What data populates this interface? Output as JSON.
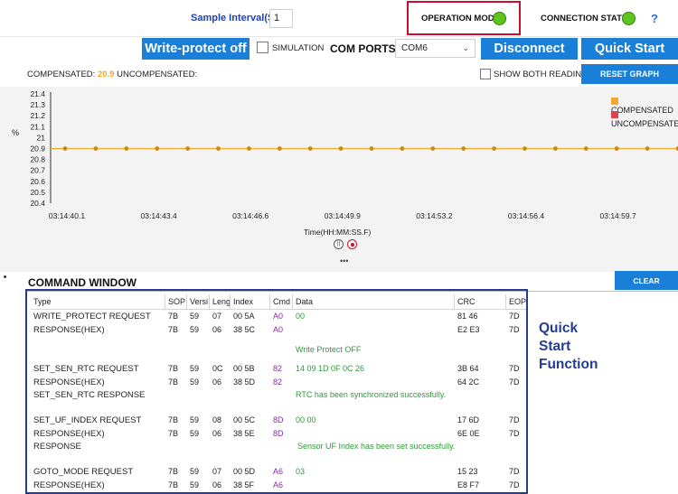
{
  "header": {
    "sample_interval_label": "Sample Interval(S)",
    "sample_interval_value": "1",
    "operation_mode_label": "OPERATION MODE",
    "connection_status_label": "CONNECTION STATUS",
    "help_label": "?",
    "status_led_color": "#5fc41d"
  },
  "toolbar": {
    "write_protect_label": "Write-protect off",
    "simulation_label": "SIMULATION",
    "com_ports_label": "COM PORTS",
    "com_port_selected": "COM6",
    "disconnect_label": "Disconnect",
    "quick_start_label": "Quick Start",
    "accent_color": "#1a7fd9"
  },
  "readings": {
    "compensated_label": "COMPENSATED:",
    "compensated_value": "20.9",
    "uncompensated_label": "UNCOMPENSATED:",
    "show_both_label": "SHOW BOTH READINGS",
    "reset_graph_label": "RESET GRAPH"
  },
  "chart_data": {
    "type": "line",
    "ylabel": "%",
    "xlabel": "Time(HH:MM:SS.F)",
    "ylim": [
      20.4,
      21.4
    ],
    "yticks": [
      "21.4",
      "21.3",
      "21.2",
      "21.1",
      "21",
      "20.9",
      "20.8",
      "20.7",
      "20.6",
      "20.5",
      "20.4"
    ],
    "x_ticks": [
      "03:14:40.1",
      "03:14:43.4",
      "03:14:46.6",
      "03:14:49.9",
      "03:14:53.2",
      "03:14:56.4",
      "03:14:59.7"
    ],
    "legend_position": "top-right",
    "series": [
      {
        "name": "COMPENSATED",
        "color": "#f0a830",
        "values": [
          20.9,
          20.9,
          20.9,
          20.9,
          20.9,
          20.9,
          20.9,
          20.9,
          20.9,
          20.9,
          20.9,
          20.9,
          20.9,
          20.9,
          20.9,
          20.9,
          20.9,
          20.9,
          20.9,
          20.9,
          20.9
        ]
      },
      {
        "name": "UNCOMPENSATED",
        "color": "#d94452",
        "values": []
      }
    ]
  },
  "command_window": {
    "title": "COMMAND WINDOW",
    "clear_label": "CLEAR",
    "columns": [
      "Type",
      "SOP",
      "Versi",
      "Leng",
      "Index",
      "Cmd",
      "Data",
      "CRC",
      "EOP"
    ],
    "rows": [
      {
        "type": "WRITE_PROTECT REQUEST",
        "sop": "7B",
        "ver": "59",
        "len": "07",
        "index": "00 5A",
        "cmd": "A0",
        "data": "00",
        "crc": "81 46",
        "eop": "7D"
      },
      {
        "type": "RESPONSE(HEX)",
        "sop": "7B",
        "ver": "59",
        "len": "06",
        "index": "38 5C",
        "cmd": "A0",
        "data": "",
        "crc": "E2 E3",
        "eop": "7D"
      },
      {
        "type": "",
        "sop": "",
        "ver": "",
        "len": "",
        "index": "",
        "cmd": "",
        "data": "Write Protect OFF",
        "crc": "",
        "eop": ""
      },
      {
        "type": "SET_SEN_RTC REQUEST",
        "sop": "7B",
        "ver": "59",
        "len": "0C",
        "index": "00 5B",
        "cmd": "82",
        "data": "14 09 1D 0F 0C 26",
        "crc": "3B 64",
        "eop": "7D"
      },
      {
        "type": "RESPONSE(HEX)",
        "sop": "7B",
        "ver": "59",
        "len": "06",
        "index": "38 5D",
        "cmd": "82",
        "data": "",
        "crc": "64 2C",
        "eop": "7D"
      },
      {
        "type": "SET_SEN_RTC RESPONSE",
        "sop": "",
        "ver": "",
        "len": "",
        "index": "",
        "cmd": "",
        "data": "RTC has been synchronized successfully.",
        "crc": "",
        "eop": ""
      },
      {
        "type": "SET_UF_INDEX REQUEST",
        "sop": "7B",
        "ver": "59",
        "len": "08",
        "index": "00 5C",
        "cmd": "8D",
        "data": "00 00",
        "crc": "17 6D",
        "eop": "7D"
      },
      {
        "type": "RESPONSE(HEX)",
        "sop": "7B",
        "ver": "59",
        "len": "06",
        "index": "38 5E",
        "cmd": "8D",
        "data": "",
        "crc": "6E 0E",
        "eop": "7D"
      },
      {
        "type": "RESPONSE",
        "sop": "",
        "ver": "",
        "len": "",
        "index": "",
        "cmd": "",
        "data": "Sensor UF Index has been set successfully.",
        "crc": "",
        "eop": ""
      },
      {
        "type": "GOTO_MODE REQUEST",
        "sop": "7B",
        "ver": "59",
        "len": "07",
        "index": "00 5D",
        "cmd": "A6",
        "data": "03",
        "crc": "15 23",
        "eop": "7D"
      },
      {
        "type": "RESPONSE(HEX)",
        "sop": "7B",
        "ver": "59",
        "len": "06",
        "index": "38 5F",
        "cmd": "A6",
        "data": "",
        "crc": "E8 F7",
        "eop": "7D"
      }
    ]
  },
  "annotation": {
    "lines": [
      "Quick",
      "Start",
      "Function"
    ]
  }
}
